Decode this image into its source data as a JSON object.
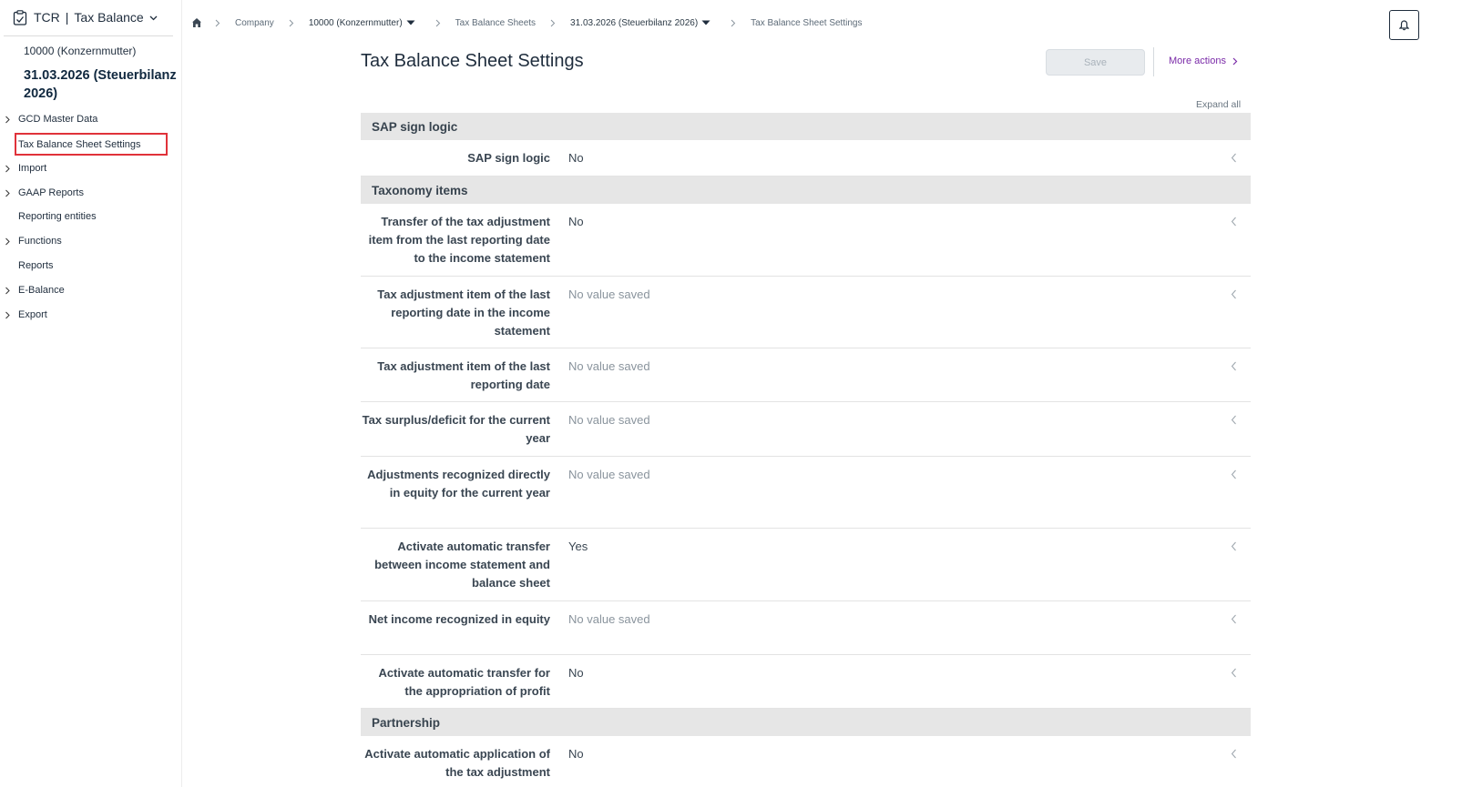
{
  "app": {
    "name": "TCR",
    "module": "Tax Balance",
    "company": "10000 (Konzernmutter)",
    "date": "31.03.2026 (Steuerbilanz 2026)"
  },
  "sidebar": {
    "items": [
      {
        "label": "GCD Master Data",
        "expandable": true
      },
      {
        "label": "Tax Balance Sheet Settings",
        "expandable": false,
        "active": true
      },
      {
        "label": "Import",
        "expandable": true
      },
      {
        "label": "GAAP Reports",
        "expandable": true
      },
      {
        "label": "Reporting entities",
        "expandable": false
      },
      {
        "label": "Functions",
        "expandable": true
      },
      {
        "label": "Reports",
        "expandable": false
      },
      {
        "label": "E-Balance",
        "expandable": true
      },
      {
        "label": "Export",
        "expandable": true
      }
    ]
  },
  "breadcrumb": {
    "items": [
      "Company",
      "10000 (Konzernmutter)",
      "Tax Balance Sheets",
      "31.03.2026 (Steuerbilanz 2026)",
      "Tax Balance Sheet Settings"
    ]
  },
  "main": {
    "title": "Tax Balance Sheet Settings",
    "save_label": "Save",
    "more_actions_label": "More actions",
    "expand_all_label": "Expand all",
    "sections": [
      {
        "title": "SAP sign logic",
        "rows": [
          {
            "label": "SAP sign logic",
            "value": "No",
            "muted": false
          }
        ]
      },
      {
        "title": "Taxonomy items",
        "rows": [
          {
            "label": "Transfer of the tax adjustment item from the last reporting date to the income statement",
            "value": "No",
            "muted": false
          },
          {
            "label": "Tax adjustment item of the last reporting date in the income statement",
            "value": "No value saved",
            "muted": true
          },
          {
            "label": "Tax adjustment item of the last reporting date",
            "value": "No value saved",
            "muted": true
          },
          {
            "label": "Tax surplus/deficit for the current year",
            "value": "No value saved",
            "muted": true
          },
          {
            "label": "Adjustments recognized directly in equity for the current year",
            "value": "No value saved",
            "muted": true
          },
          {
            "label": "Activate automatic transfer between income statement and balance sheet",
            "value": "Yes",
            "muted": false
          },
          {
            "label": "Net income recognized in equity",
            "value": "No value saved",
            "muted": true
          },
          {
            "label": "Activate automatic transfer for the appropriation of profit",
            "value": "No",
            "muted": false
          }
        ]
      },
      {
        "title": "Partnership",
        "rows": [
          {
            "label": "Activate automatic application of the tax adjustment",
            "value": "No",
            "muted": false
          }
        ]
      }
    ]
  },
  "colors": {
    "active_outline": "#e0323a",
    "link": "#7a2aa8",
    "section_bg": "#e6e6e6"
  }
}
